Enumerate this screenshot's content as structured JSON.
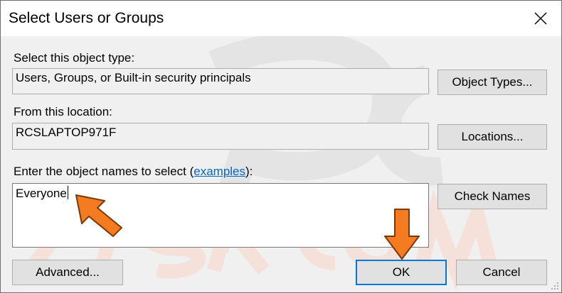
{
  "window": {
    "title": "Select Users or Groups"
  },
  "object_type": {
    "label": "Select this object type:",
    "value": "Users, Groups, or Built-in security principals",
    "button": "Object Types..."
  },
  "location": {
    "label": "From this location:",
    "value": "RCSLAPTOP971F",
    "button": "Locations..."
  },
  "names": {
    "label_before": "Enter the object names to select (",
    "link": "examples",
    "label_after": "):",
    "value": "Everyone",
    "check_button": "Check Names"
  },
  "footer": {
    "advanced": "Advanced...",
    "ok": "OK",
    "cancel": "Cancel"
  },
  "colors": {
    "annotation_arrow": "#f47b20",
    "link": "#0066cc",
    "default_button_border": "#0078d7"
  },
  "icons": [
    "close-icon",
    "arrow-annotation-icon",
    "resize-grip-icon"
  ]
}
